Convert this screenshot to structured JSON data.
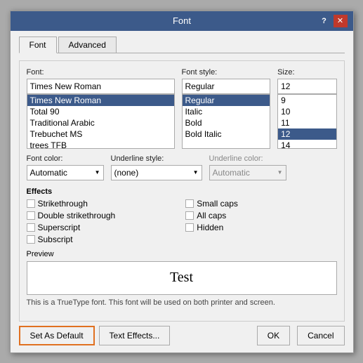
{
  "dialog": {
    "title": "Font",
    "help_label": "?",
    "close_label": "✕"
  },
  "tabs": [
    {
      "id": "font",
      "label": "Font",
      "active": true
    },
    {
      "id": "advanced",
      "label": "Advanced",
      "active": false
    }
  ],
  "font_section": {
    "font_label": "Font:",
    "font_value": "Times New Roman",
    "font_list": [
      {
        "label": "Times New Roman",
        "selected": true
      },
      {
        "label": "Total 90",
        "selected": false
      },
      {
        "label": "Traditional Arabic",
        "selected": false
      },
      {
        "label": "Trebuchet MS",
        "selected": false
      },
      {
        "label": "trees TFB",
        "selected": false
      }
    ],
    "style_label": "Font style:",
    "style_value": "Regular",
    "style_list": [
      {
        "label": "Regular",
        "selected": true
      },
      {
        "label": "Italic",
        "selected": false
      },
      {
        "label": "Bold",
        "selected": false
      },
      {
        "label": "Bold Italic",
        "selected": false
      }
    ],
    "size_label": "Size:",
    "size_value": "12",
    "size_list": [
      {
        "label": "9",
        "selected": false
      },
      {
        "label": "10",
        "selected": false
      },
      {
        "label": "11",
        "selected": false
      },
      {
        "label": "12",
        "selected": true
      },
      {
        "label": "14",
        "selected": false
      }
    ]
  },
  "dropdowns": {
    "font_color_label": "Font color:",
    "font_color_value": "Automatic",
    "underline_style_label": "Underline style:",
    "underline_style_value": "(none)",
    "underline_color_label": "Underline color:",
    "underline_color_value": "Automatic",
    "underline_color_disabled": true
  },
  "effects": {
    "title": "Effects",
    "left_items": [
      {
        "label": "Strikethrough",
        "checked": false
      },
      {
        "label": "Double strikethrough",
        "checked": false
      },
      {
        "label": "Superscript",
        "checked": false
      },
      {
        "label": "Subscript",
        "checked": false
      }
    ],
    "right_items": [
      {
        "label": "Small caps",
        "checked": false
      },
      {
        "label": "All caps",
        "checked": false
      },
      {
        "label": "Hidden",
        "checked": false
      }
    ]
  },
  "preview": {
    "label": "Preview",
    "text": "Test",
    "note": "This is a TrueType font. This font will be used on both printer and screen."
  },
  "buttons": {
    "set_default": "Set As Default",
    "text_effects": "Text Effects...",
    "ok": "OK",
    "cancel": "Cancel"
  }
}
